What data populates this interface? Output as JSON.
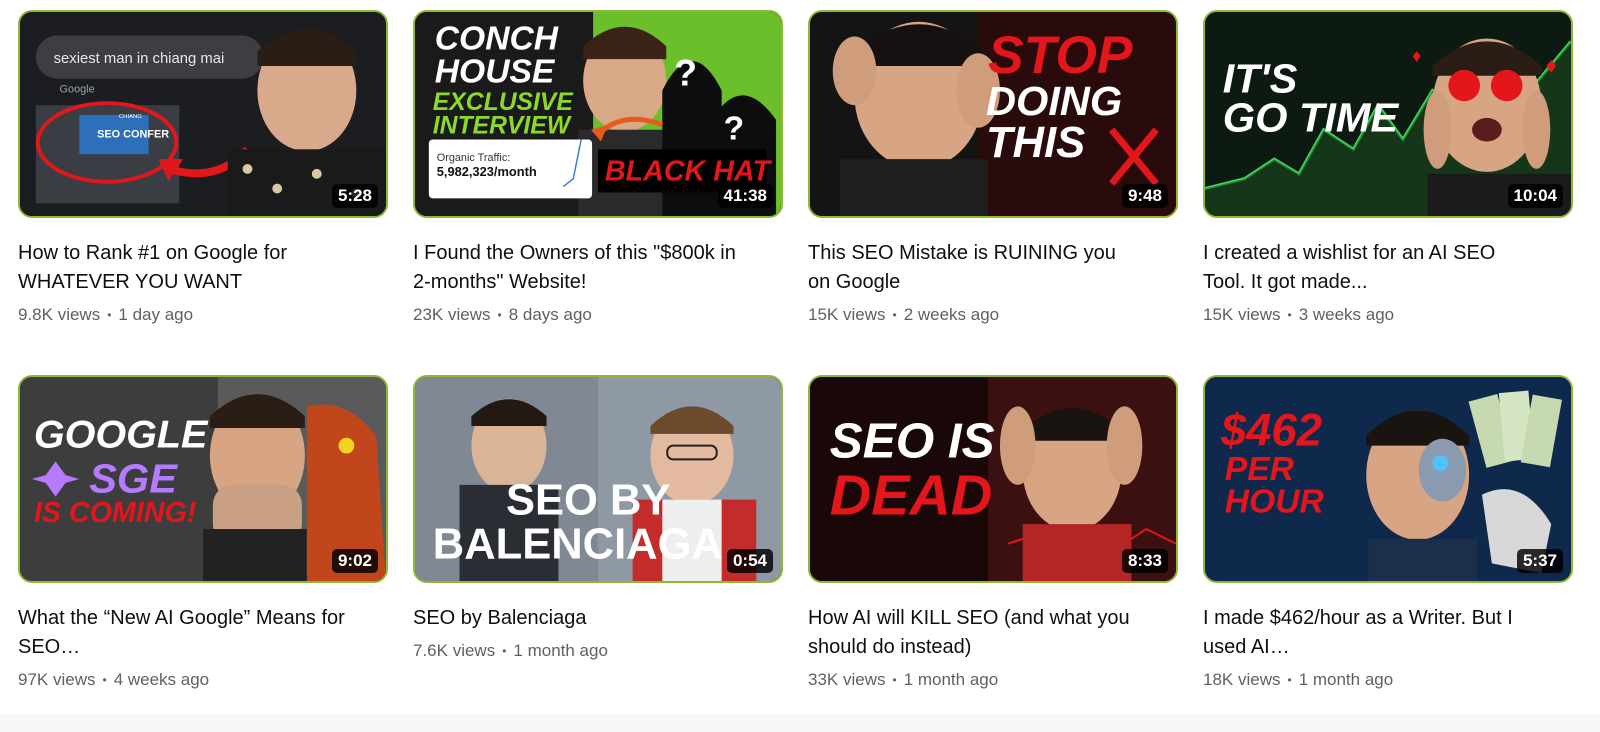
{
  "videos": [
    {
      "title": "How to Rank #1 on Google for WHATEVER YOU WANT",
      "views": "9.8K views",
      "age": "1 day ago",
      "duration": "5:28",
      "thumb": {
        "search": "sexiest man in chiang mai",
        "brand": "Google",
        "badge": "SEO CONFER",
        "badge_small": "CHIANG"
      }
    },
    {
      "title": "I Found the Owners of this \"$800k in 2-months\" Website!",
      "views": "23K views",
      "age": "8 days ago",
      "duration": "41:38",
      "thumb": {
        "line1": "CONCH",
        "line2": "HOUSE",
        "line3": "EXCLUSIVE",
        "line4": "INTERVIEW",
        "traffic_label": "Organic Traffic:",
        "traffic_value": "5,982,323/month",
        "tag": "BLACK HAT",
        "q": "?"
      }
    },
    {
      "title": "This SEO Mistake is RUINING you on Google",
      "views": "15K views",
      "age": "2 weeks ago",
      "duration": "9:48",
      "thumb": {
        "line1": "STOP",
        "line2": "DOING",
        "line3": "THIS"
      }
    },
    {
      "title": "I created a wishlist for an AI SEO Tool. It got made...",
      "views": "15K views",
      "age": "3 weeks ago",
      "duration": "10:04",
      "thumb": {
        "line1": "IT'S",
        "line2": "GO TIME"
      }
    },
    {
      "title": "What the “New AI Google” Means for SEO…",
      "views": "97K views",
      "age": "4 weeks ago",
      "duration": "9:02",
      "thumb": {
        "line1": "GOOGLE",
        "line2": "SGE",
        "line3": "IS COMING!"
      }
    },
    {
      "title": "SEO by Balenciaga",
      "views": "7.6K views",
      "age": "1 month ago",
      "duration": "0:54",
      "thumb": {
        "line1": "SEO BY",
        "line2": "BALENCIAGA"
      }
    },
    {
      "title": "How AI will KILL SEO (and what you should do instead)",
      "views": "33K views",
      "age": "1 month ago",
      "duration": "8:33",
      "thumb": {
        "line1": "SEO IS",
        "line2": "DEAD"
      }
    },
    {
      "title": "I made $462/hour as a Writer. But I used AI…",
      "views": "18K views",
      "age": "1 month ago",
      "duration": "5:37",
      "thumb": {
        "line1": "$462",
        "line2": "PER",
        "line3": "HOUR"
      }
    }
  ],
  "colors": {
    "accent_red": "#e3171b",
    "accent_green": "#7ed321",
    "meta_gray": "#606060",
    "thumb_border": "#8fb83a"
  },
  "meta_separator": "•"
}
